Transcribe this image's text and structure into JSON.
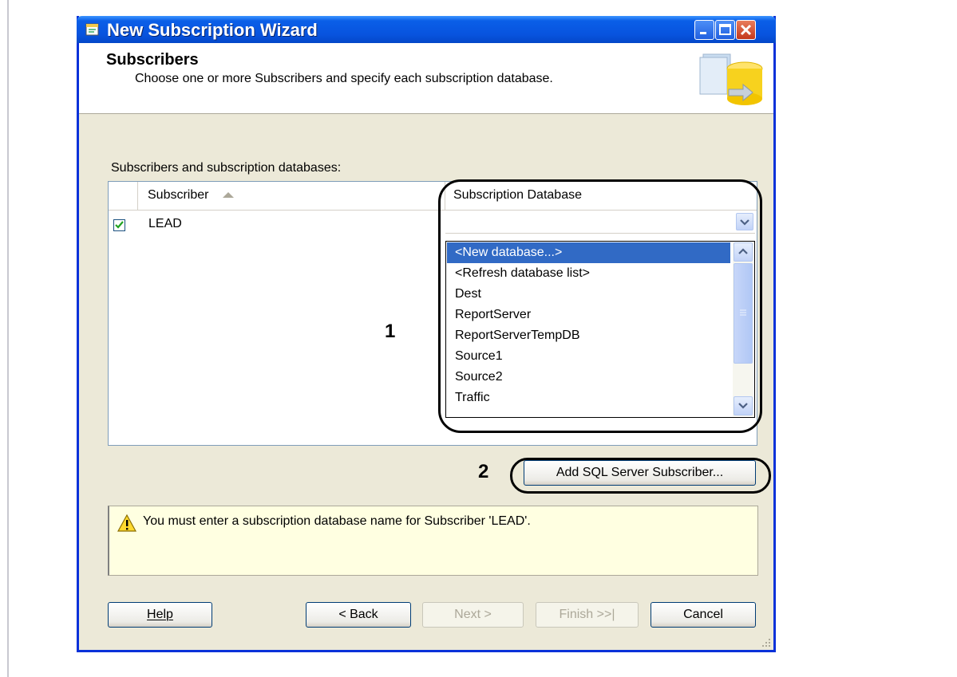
{
  "window": {
    "title": "New Subscription Wizard"
  },
  "header": {
    "title": "Subscribers",
    "subtitle": "Choose one or more Subscribers and specify each subscription database."
  },
  "grid": {
    "label": "Subscribers and subscription databases:",
    "columns": [
      "Subscriber",
      "Subscription Database"
    ],
    "rows": [
      {
        "subscriber": "LEAD",
        "checked": true,
        "database": ""
      }
    ]
  },
  "dropdown": {
    "options": [
      "<New database...>",
      "<Refresh database list>",
      "Dest",
      "ReportServer",
      "ReportServerTempDB",
      "Source1",
      "Source2",
      "Traffic"
    ],
    "selected": "<New database...>"
  },
  "annotations": {
    "marker1": "1",
    "marker2": "2"
  },
  "add_subscriber_label": "Add SQL Server Subscriber...",
  "message": "You must enter a subscription database name for Subscriber 'LEAD'.",
  "buttons": {
    "help": "Help",
    "back": "< Back",
    "next": "Next >",
    "finish": "Finish >>|",
    "cancel": "Cancel"
  },
  "colors": {
    "titlebar": "#0853de",
    "selection": "#316ac5",
    "message_bg": "#ffffe1",
    "dialog_bg": "#ece9d8"
  }
}
